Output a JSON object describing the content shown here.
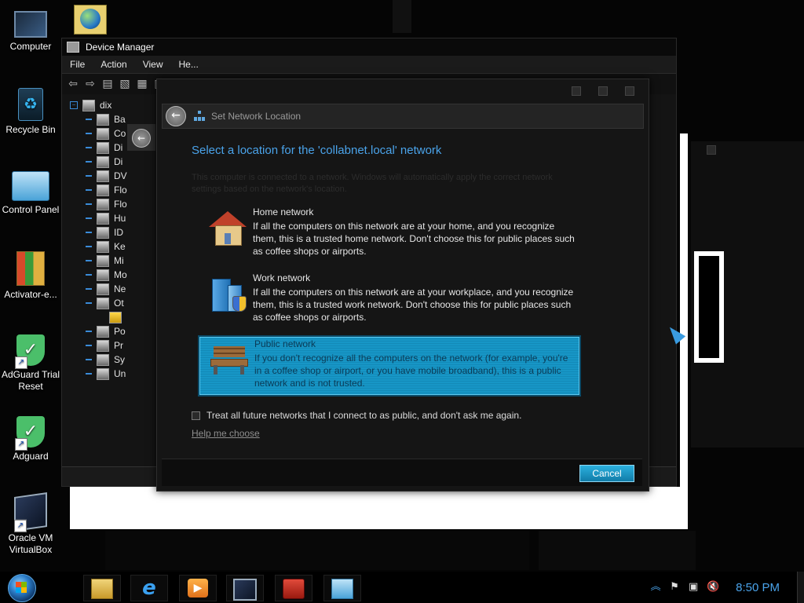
{
  "desktop": {
    "icons": [
      {
        "label": "Computer"
      },
      {
        "label": "Recycle Bin"
      },
      {
        "label": "Control Panel"
      },
      {
        "label": "Activator-e..."
      },
      {
        "label": "AdGuard Trial Reset"
      },
      {
        "label": "Adguard"
      },
      {
        "label": "Oracle VM VirtualBox"
      }
    ]
  },
  "device_manager": {
    "title": "Device Manager",
    "menu": [
      "File",
      "Action",
      "View",
      "He..."
    ],
    "tree_root": "dix",
    "tree_items": [
      "Ba",
      "Co",
      "Di",
      "Di",
      "DV",
      "Flo",
      "Flo",
      "Hu",
      "ID",
      "Ke",
      "Mi",
      "Mo",
      "Ne",
      "Ot",
      "",
      "Po",
      "Pr",
      "Sy",
      "Un"
    ]
  },
  "dialog": {
    "header_title": "Set Network Location",
    "main_title": "Select a location for the 'collabnet.local' network",
    "intro": "This computer is connected to a network. Windows will automatically apply the correct network settings based on the network's location.",
    "options": [
      {
        "name": "Home network",
        "description": "If all the computers on this network are at your home, and you recognize them, this is a trusted home network.  Don't choose this for public places such as coffee shops or airports.",
        "icon": "home-icon"
      },
      {
        "name": "Work network",
        "description": "If all the computers on this network are at your workplace, and you recognize them, this is a trusted work network.  Don't choose this for public places such as coffee shops or airports.",
        "icon": "work-building-icon"
      },
      {
        "name": "Public network",
        "description": "If you don't recognize all the computers on the network (for example, you're in a coffee shop or airport, or you have mobile broadband), this is a public network and is not trusted.",
        "icon": "bench-icon",
        "selected": true
      }
    ],
    "checkbox_label": "Treat all future networks that I connect to as public, and don't ask me again.",
    "checkbox_checked": false,
    "help_link": "Help me choose",
    "cancel_label": "Cancel"
  },
  "taskbar": {
    "apps": [
      "file-explorer-icon",
      "internet-explorer-icon",
      "media-player-icon",
      "virtualbox-icon",
      "toolbox-icon",
      "control-panel-icon"
    ],
    "clock": "8:50 PM"
  },
  "colors": {
    "accent": "#4aa3ea",
    "selected_option": "#1796c6",
    "background": "#050505"
  }
}
